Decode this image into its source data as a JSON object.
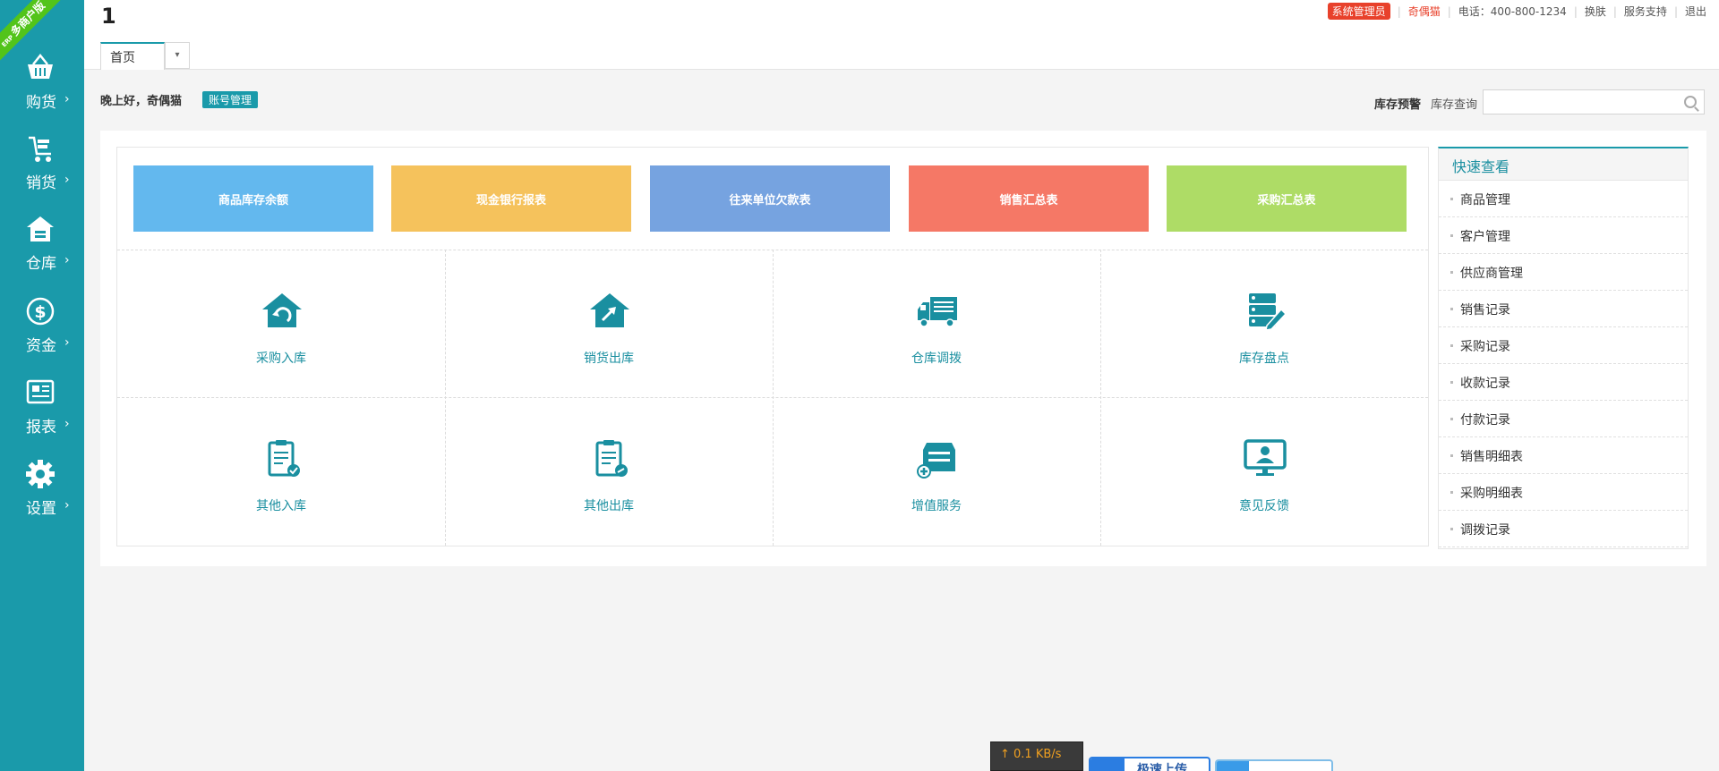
{
  "brand": {
    "ribbon_small": "ERP",
    "ribbon_text": "多商户版"
  },
  "sidebar": {
    "items": [
      {
        "label": "购货",
        "icon": "basket-icon"
      },
      {
        "label": "销货",
        "icon": "cart-icon"
      },
      {
        "label": "仓库",
        "icon": "warehouse-icon"
      },
      {
        "label": "资金",
        "icon": "dollar-icon"
      },
      {
        "label": "报表",
        "icon": "report-icon"
      },
      {
        "label": "设置",
        "icon": "gear-icon"
      }
    ],
    "chevron": "›"
  },
  "header": {
    "page_number": "1",
    "admin_badge": "系统管理员",
    "username": "奇偶猫",
    "phone": "电话：400-800-1234",
    "skin": "换肤",
    "support": "服务支持",
    "logout": "退出",
    "separator": "|"
  },
  "tabs": {
    "home": "首页",
    "dropdown": "▾"
  },
  "toolbar": {
    "greeting": "晚上好，奇偶猫",
    "account_btn": "账号管理",
    "stock_alert": "库存预警",
    "stock_query": "库存查询",
    "search_placeholder": ""
  },
  "tiles": [
    {
      "label": "商品库存余额",
      "color": "#63b8ee"
    },
    {
      "label": "现金银行报表",
      "color": "#f5c25c"
    },
    {
      "label": "往来单位欠款表",
      "color": "#76a3e0"
    },
    {
      "label": "销售汇总表",
      "color": "#f57866"
    },
    {
      "label": "采购汇总表",
      "color": "#aedc66"
    }
  ],
  "shortcuts": [
    {
      "label": "采购入库",
      "icon": "purchase-inbound-icon"
    },
    {
      "label": "销货出库",
      "icon": "sales-outbound-icon"
    },
    {
      "label": "仓库调拨",
      "icon": "transfer-truck-icon"
    },
    {
      "label": "库存盘点",
      "icon": "inventory-check-icon"
    },
    {
      "label": "其他入库",
      "icon": "other-inbound-icon"
    },
    {
      "label": "其他出库",
      "icon": "other-outbound-icon"
    },
    {
      "label": "增值服务",
      "icon": "value-added-icon"
    },
    {
      "label": "意见反馈",
      "icon": "feedback-icon"
    }
  ],
  "quick_view": {
    "title": "快速查看",
    "items": [
      "商品管理",
      "客户管理",
      "供应商管理",
      "销售记录",
      "采购记录",
      "收款记录",
      "付款记录",
      "销售明细表",
      "采购明细表",
      "调拨记录"
    ]
  },
  "widgets": {
    "speed": "↑ 0.1 KB/s",
    "upload": "极速上传"
  },
  "colors": {
    "accent": "#1a9aaa",
    "danger": "#e8412b"
  }
}
